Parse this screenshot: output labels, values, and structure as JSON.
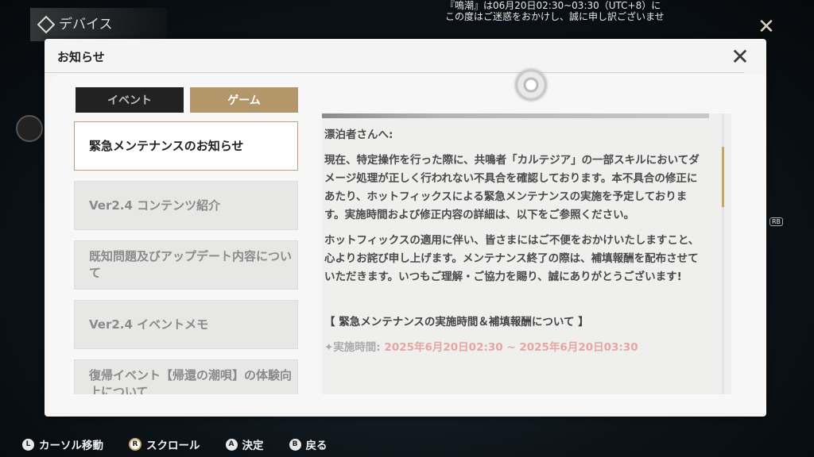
{
  "background": {
    "section_title": "デバイス",
    "marquee_line1": "『鳴潮』は06月20日02:30~03:30（UTC+8）に",
    "marquee_line2": "この度はご迷惑をおかけし、誠に申し訳ございませ",
    "rb_label": "RB"
  },
  "modal": {
    "title": "お知らせ",
    "close_icon": "close-x-icon"
  },
  "tabs": [
    {
      "label": "イベント",
      "selected": false
    },
    {
      "label": "ゲーム",
      "selected": true
    }
  ],
  "list": [
    {
      "label": "緊急メンテナンスのお知らせ",
      "active": true
    },
    {
      "label": "Ver2.4 コンテンツ紹介",
      "active": false
    },
    {
      "label": "既知問題及びアップデート内容について",
      "active": false
    },
    {
      "label": "Ver2.4 イベントメモ",
      "active": false
    },
    {
      "label": "復帰イベント【帰還の潮唄】の体験向上について",
      "active": false
    }
  ],
  "article": {
    "greeting": "漂泊者さんへ:",
    "para1": "現在、特定操作を行った際に、共鳴者「カルテジア」の一部スキルにおいてダメージ処理が正しく行われない不具合を確認しております。本不具合の修正にあたり、ホットフィックスによる緊急メンテナンスの実施を予定しております。実施時間および修正内容の詳細は、以下をご参照ください。",
    "para2": "ホットフィックスの適用に伴い、皆さまにはご不便をおかけいたしますこと、心よりお詫び申し上げます。メンテナンス終了の際は、補填報酬を配布させていただきます。いつもご理解・ご協力を賜り、誠にありがとうございます!",
    "heading": "【 緊急メンテナンスの実施時間＆補填報酬について 】",
    "time_label": "✦実施時間:",
    "time_value": "2025年6月20日02:30 ~ 2025年6月20日03:30"
  },
  "bottom_hints": [
    {
      "glyph": "L",
      "label": "カーソル移動"
    },
    {
      "glyph": "R",
      "label": "スクロール"
    },
    {
      "glyph": "A",
      "label": "決定"
    },
    {
      "glyph": "B",
      "label": "戻る"
    }
  ]
}
